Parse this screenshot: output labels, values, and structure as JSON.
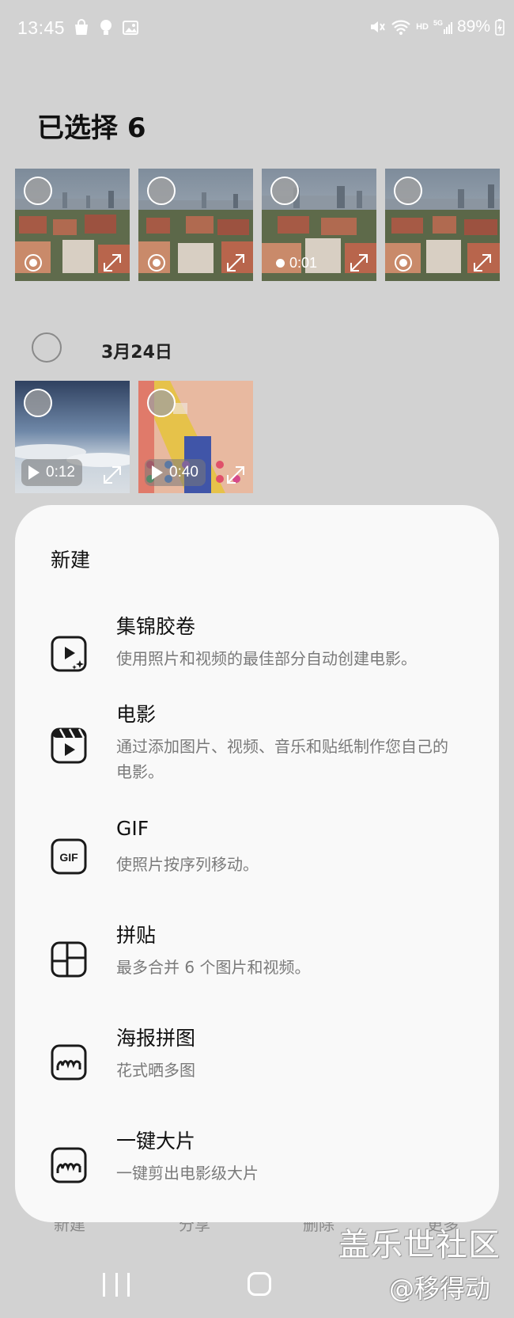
{
  "status_bar": {
    "time": "13:45",
    "battery": "89%"
  },
  "page_title": "已选择 6",
  "thumbnails_row1": [
    {
      "type": "live_photo"
    },
    {
      "type": "live_photo"
    },
    {
      "type": "video",
      "duration": "0:01"
    },
    {
      "type": "live_photo"
    }
  ],
  "date_group": {
    "label": "3月24日"
  },
  "thumbnails_row2": [
    {
      "type": "video",
      "duration": "0:12"
    },
    {
      "type": "video",
      "duration": "0:40"
    }
  ],
  "sheet": {
    "title": "新建",
    "options": [
      {
        "icon": "highlight-reel-icon",
        "title": "集锦胶卷",
        "description": "使用照片和视频的最佳部分自动创建电影。"
      },
      {
        "icon": "movie-clapper-icon",
        "title": "电影",
        "description": "通过添加图片、视频、音乐和贴纸制作您自己的电影。"
      },
      {
        "icon": "gif-icon",
        "title": "GIF",
        "description": "使照片按序列移动。"
      },
      {
        "icon": "collage-icon",
        "title": "拼贴",
        "description": "最多合并 6 个图片和视频。"
      },
      {
        "icon": "poster-collage-icon",
        "title": "海报拼图",
        "description": "花式晒多图"
      },
      {
        "icon": "one-tap-blockbuster-icon",
        "title": "一键大片",
        "description": "一键剪出电影级大片"
      }
    ]
  },
  "bottom_toolbar": {
    "new_label": "新建",
    "share_label": "分享",
    "delete_label": "删除",
    "more_label": "更多"
  },
  "watermark": {
    "line1": "盖乐世社区",
    "line2": "@移得动"
  }
}
